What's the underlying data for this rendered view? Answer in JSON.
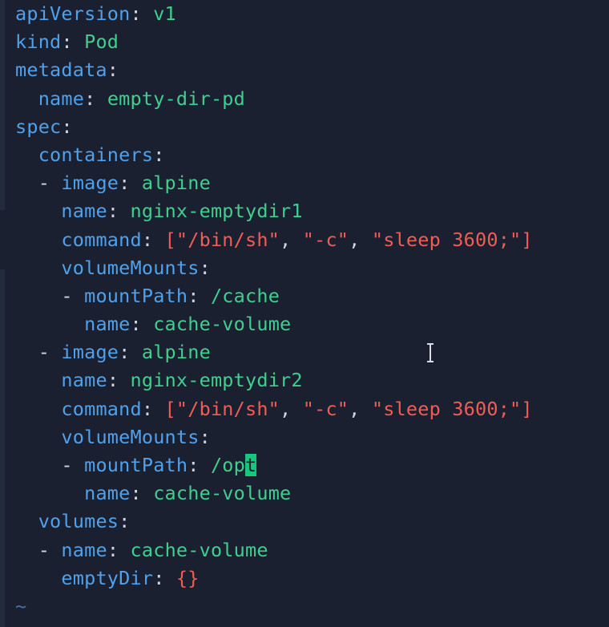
{
  "colors": {
    "background": "#1b2030",
    "key": "#4fa1ec",
    "value": "#3fcf8e",
    "string": "#f25c54",
    "punctuation": "#cfd6e2",
    "cursor": "#16c77d"
  },
  "icons": {
    "text_cursor": "i-beam-cursor-icon"
  },
  "lines": [
    {
      "indent": "",
      "dash": "",
      "key": "apiVersion",
      "colon": ":",
      "value": " v1",
      "value_type": "v"
    },
    {
      "indent": "",
      "dash": "",
      "key": "kind",
      "colon": ":",
      "value": " Pod",
      "value_type": "v"
    },
    {
      "indent": "",
      "dash": "",
      "key": "metadata",
      "colon": ":",
      "value": "",
      "value_type": "v"
    },
    {
      "indent": "  ",
      "dash": "",
      "key": "name",
      "colon": ":",
      "value": " empty-dir-pd",
      "value_type": "v"
    },
    {
      "indent": "",
      "dash": "",
      "key": "spec",
      "colon": ":",
      "value": "",
      "value_type": "v"
    },
    {
      "indent": "  ",
      "dash": "",
      "key": "containers",
      "colon": ":",
      "value": "",
      "value_type": "v"
    },
    {
      "indent": "  ",
      "dash": "- ",
      "key": "image",
      "colon": ":",
      "value": " alpine",
      "value_type": "v"
    },
    {
      "indent": "    ",
      "dash": "",
      "key": "name",
      "colon": ":",
      "value": " nginx-emptydir1",
      "value_type": "v"
    },
    {
      "indent": "    ",
      "dash": "",
      "key": "command",
      "colon": ":",
      "value": " [\"/bin/sh\", \"-c\", \"sleep 3600;\"]",
      "value_type": "cmd"
    },
    {
      "indent": "    ",
      "dash": "",
      "key": "volumeMounts",
      "colon": ":",
      "value": "",
      "value_type": "v"
    },
    {
      "indent": "    ",
      "dash": "- ",
      "key": "mountPath",
      "colon": ":",
      "value": " /cache",
      "value_type": "v"
    },
    {
      "indent": "      ",
      "dash": "",
      "key": "name",
      "colon": ":",
      "value": " cache-volume",
      "value_type": "v"
    },
    {
      "indent": "  ",
      "dash": "- ",
      "key": "image",
      "colon": ":",
      "value": " alpine",
      "value_type": "v"
    },
    {
      "indent": "    ",
      "dash": "",
      "key": "name",
      "colon": ":",
      "value": " nginx-emptydir2",
      "value_type": "v"
    },
    {
      "indent": "    ",
      "dash": "",
      "key": "command",
      "colon": ":",
      "value": " [\"/bin/sh\", \"-c\", \"sleep 3600;\"]",
      "value_type": "cmd"
    },
    {
      "indent": "    ",
      "dash": "",
      "key": "volumeMounts",
      "colon": ":",
      "value": "",
      "value_type": "v"
    },
    {
      "indent": "    ",
      "dash": "- ",
      "key": "mountPath",
      "colon": ":",
      "value": " /op",
      "value_type": "v",
      "cursor_char": "t"
    },
    {
      "indent": "      ",
      "dash": "",
      "key": "name",
      "colon": ":",
      "value": " cache-volume",
      "value_type": "v"
    },
    {
      "indent": "  ",
      "dash": "",
      "key": "volumes",
      "colon": ":",
      "value": "",
      "value_type": "v"
    },
    {
      "indent": "  ",
      "dash": "- ",
      "key": "name",
      "colon": ":",
      "value": " cache-volume",
      "value_type": "v"
    },
    {
      "indent": "    ",
      "dash": "",
      "key": "emptyDir",
      "colon": ":",
      "value": " {}",
      "value_type": "s"
    }
  ],
  "tilde": "~"
}
